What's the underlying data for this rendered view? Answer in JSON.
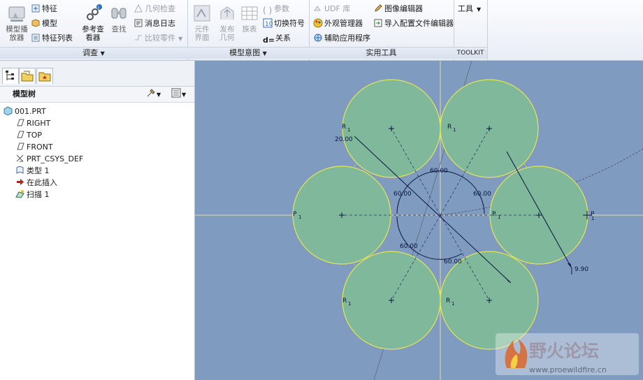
{
  "ribbon": {
    "investigate": {
      "label": "调查",
      "model_player": "模型播\n放器",
      "feature": "特征",
      "model": "模型",
      "feature_list": "特征列表",
      "ref_viewer": "参考查\n看器",
      "find": "查找",
      "geom_check": "几何检查",
      "message_log": "消息日志",
      "compare_part": "比较零件"
    },
    "model_intent": {
      "label": "模型意图",
      "component_interface": "元件\n界面",
      "publish_geom": "发布\n几何",
      "family_table": "族表",
      "params": "参数",
      "switch_symbol": "切换符号",
      "relations": "关系"
    },
    "utilities": {
      "label": "实用工具",
      "udf_lib": "UDF 库",
      "appearance_mgr": "外观管理器",
      "aux_app": "辅助应用程序",
      "image_editor": "图像编辑器",
      "import_config": "导入配置文件编辑器"
    },
    "tools_label": "工具",
    "toolkit_label": "TOOLKIT"
  },
  "model_tree": {
    "header": "模型树",
    "items": [
      {
        "label": "001.PRT",
        "icon": "part-icon"
      },
      {
        "label": "RIGHT",
        "icon": "datum-plane-icon"
      },
      {
        "label": "TOP",
        "icon": "datum-plane-icon"
      },
      {
        "label": "FRONT",
        "icon": "datum-plane-icon"
      },
      {
        "label": "PRT_CSYS_DEF",
        "icon": "csys-icon"
      },
      {
        "label": "类型 1",
        "icon": "type-icon"
      },
      {
        "label": "在此插入",
        "icon": "insert-arrow-icon"
      },
      {
        "label": "扫描 1",
        "icon": "sweep-icon"
      }
    ]
  },
  "sketch": {
    "dims": {
      "r20": "20.00",
      "d990": "9.90",
      "a1": "60.00",
      "a2": "60.00",
      "a3": "60.00",
      "a4": "60.00",
      "a5": "60.00"
    },
    "r_label": "R",
    "p_label": "P",
    "sub1": "1",
    "colors": {
      "background": "#7f9bc0",
      "circle_fill": "#7fb89a",
      "circle_stroke": "#e6e84e",
      "dimension": "#0a1440"
    }
  },
  "watermark": {
    "title": "野火论坛",
    "url": "www.proewildfire.cn"
  }
}
